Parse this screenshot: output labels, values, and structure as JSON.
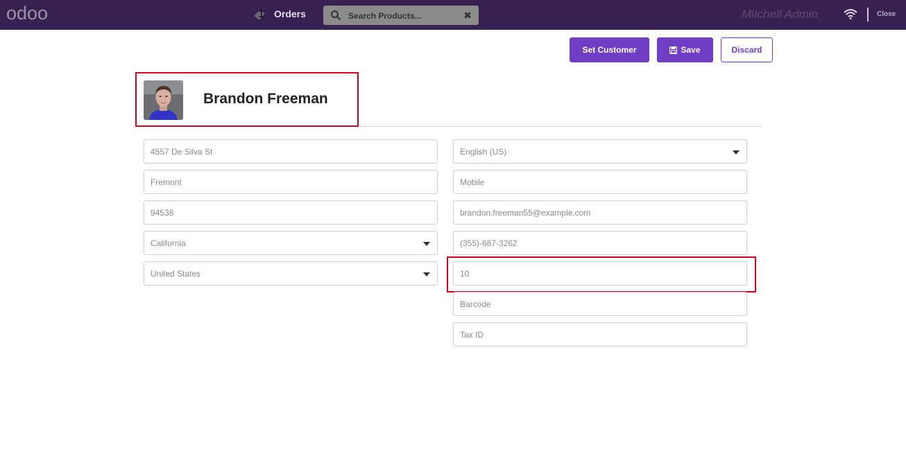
{
  "topbar": {
    "logo": "odoo",
    "orders_count": "1",
    "orders_label": "Orders",
    "search_placeholder": "Search Products...",
    "search_clear": "✖",
    "user": "Mitchell Admin",
    "close": "Close"
  },
  "actions": {
    "set_customer": "Set Customer",
    "save": "Save",
    "discard": "Discard"
  },
  "customer": {
    "name": "Brandon Freeman"
  },
  "left_fields": [
    {
      "value": "4557 De Silva St"
    },
    {
      "placeholder": "Fremont"
    },
    {
      "value": "94538"
    },
    {
      "value": "California"
    },
    {
      "value": "United States"
    }
  ],
  "right_fields": [
    {
      "value": "English (US)"
    },
    {
      "placeholder": "Mobile"
    },
    {
      "value": "brandon.freeman55@example.com"
    },
    {
      "value": "(355)-687-3262"
    },
    {
      "value": "10"
    },
    {
      "placeholder": "Barcode"
    },
    {
      "placeholder": "Tax ID"
    }
  ],
  "colors": {
    "topbar": "#362150",
    "primary": "#6f3ec4",
    "highlight": "#d0021b"
  }
}
